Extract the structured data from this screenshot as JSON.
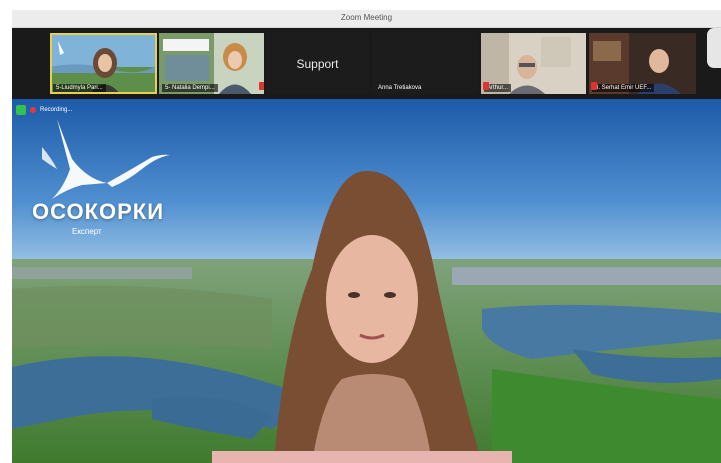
{
  "window": {
    "title": "Zoom Meeting"
  },
  "participants": [
    {
      "name": "5-Liudmyla Pari...",
      "muted": false,
      "active": true
    },
    {
      "name": "5- Natalia Dempi...",
      "muted": true,
      "active": false
    },
    {
      "name": "Support",
      "muted": false,
      "active": false
    },
    {
      "name": "Anna Tretiakova",
      "muted": false,
      "active": false
    },
    {
      "name": "Arthur...",
      "muted": true,
      "active": false
    },
    {
      "name": "3. Serhat Emir UEF...",
      "muted": true,
      "active": false
    }
  ],
  "recording": {
    "label": "Recording..."
  },
  "background": {
    "brand": "ОСОКОРКИ",
    "brand_sub": "Експерт"
  },
  "colors": {
    "active_speaker_border": "#e6d24a",
    "recording_dot": "#e23b3b",
    "security_badge": "#33c24d"
  }
}
